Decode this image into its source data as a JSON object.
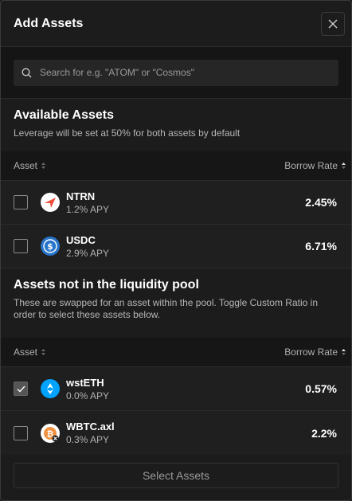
{
  "modal": {
    "title": "Add Assets"
  },
  "search": {
    "placeholder": "Search for e.g. \"ATOM\" or \"Cosmos\""
  },
  "available": {
    "title": "Available Assets",
    "subtitle": "Leverage will be set at 50% for both assets by default",
    "columns": {
      "asset": "Asset",
      "borrow_rate": "Borrow Rate"
    },
    "rows": [
      {
        "name": "NTRN",
        "apy": "1.2% APY",
        "rate": "2.45%",
        "checked": false,
        "icon": "ntrn-icon"
      },
      {
        "name": "USDC",
        "apy": "2.9% APY",
        "rate": "6.71%",
        "checked": false,
        "icon": "usdc-icon"
      }
    ]
  },
  "not_in_pool": {
    "title": "Assets not in the liquidity pool",
    "subtitle": "These are swapped for an asset within the pool. Toggle Custom Ratio in order to select these assets below.",
    "columns": {
      "asset": "Asset",
      "borrow_rate": "Borrow Rate"
    },
    "rows": [
      {
        "name": "wstETH",
        "apy": "0.0% APY",
        "rate": "0.57%",
        "checked": true,
        "icon": "wsteth-icon"
      },
      {
        "name": "WBTC.axl",
        "apy": "0.3% APY",
        "rate": "2.2%",
        "checked": false,
        "icon": "wbtc-icon"
      }
    ]
  },
  "footer": {
    "select_label": "Select Assets"
  },
  "colors": {
    "ntrn": "#ef4e3a",
    "usdc": "#2775ca",
    "wsteth": "#00a3ff",
    "wbtc": "#f09242"
  }
}
